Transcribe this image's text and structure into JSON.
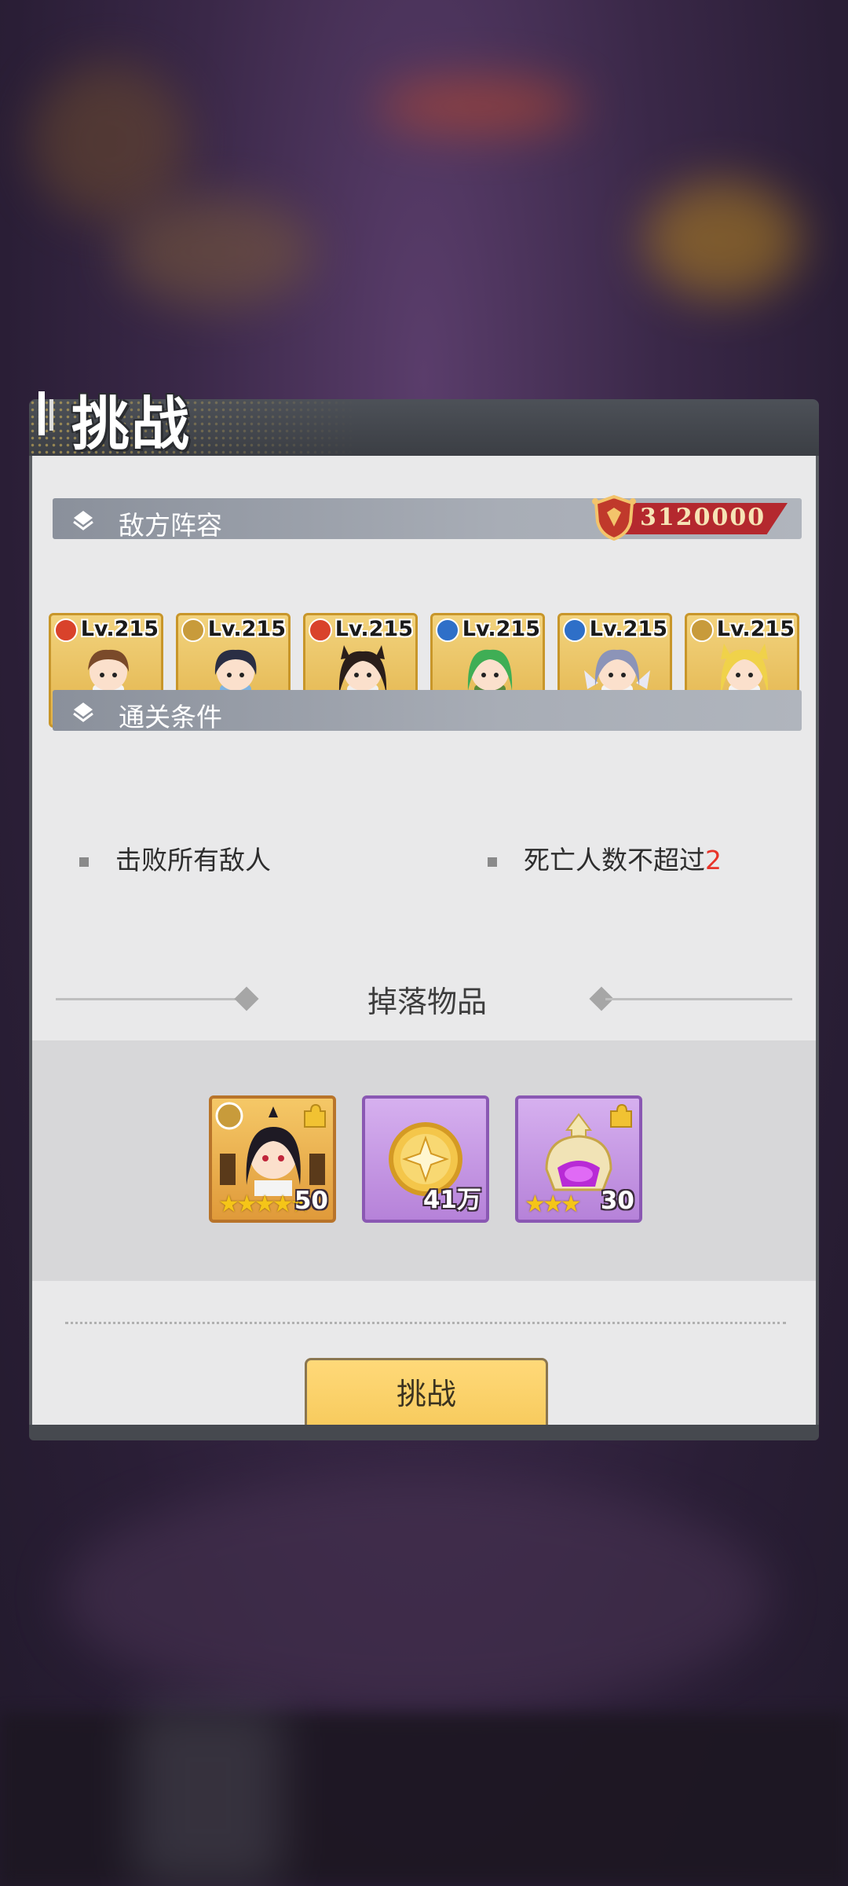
{
  "dialog": {
    "title": "挑战",
    "enemy_section": {
      "label": "敌方阵容",
      "power": "3120000"
    },
    "enemies": [
      {
        "level": "Lv.215",
        "element": "fire",
        "element_color": "#d9422b",
        "hair": "#7a4a2a"
      },
      {
        "level": "Lv.215",
        "element": "light",
        "element_color": "#c89b3b",
        "hair": "#2a2e44"
      },
      {
        "level": "Lv.215",
        "element": "fire",
        "element_color": "#d9422b",
        "hair": "#2a1e1a"
      },
      {
        "level": "Lv.215",
        "element": "water",
        "element_color": "#2e6fc8",
        "hair": "#3fae55"
      },
      {
        "level": "Lv.215",
        "element": "water",
        "element_color": "#2e6fc8",
        "hair": "#8c94b8"
      },
      {
        "level": "Lv.215",
        "element": "light",
        "element_color": "#c89b3b",
        "hair": "#f0d24a"
      }
    ],
    "clear_section": {
      "label": "通关条件",
      "conditions": [
        {
          "text": "击败所有敌人"
        },
        {
          "text": "死亡人数不超过",
          "value": "2"
        }
      ]
    },
    "drops": {
      "title": "掉落物品",
      "items": [
        {
          "type": "hero-fragment",
          "count": "50",
          "stars": "★★★★★",
          "frame": "gold"
        },
        {
          "type": "gold-coin",
          "count": "41万",
          "frame": "purple"
        },
        {
          "type": "helmet-fragment",
          "count": "30",
          "stars": "★★★",
          "frame": "purple"
        }
      ]
    },
    "challenge_button": "挑战"
  },
  "colors": {
    "accent_red": "#e8342a",
    "button_yellow": "#f6c95a",
    "power_ribbon": "#b4282e"
  }
}
